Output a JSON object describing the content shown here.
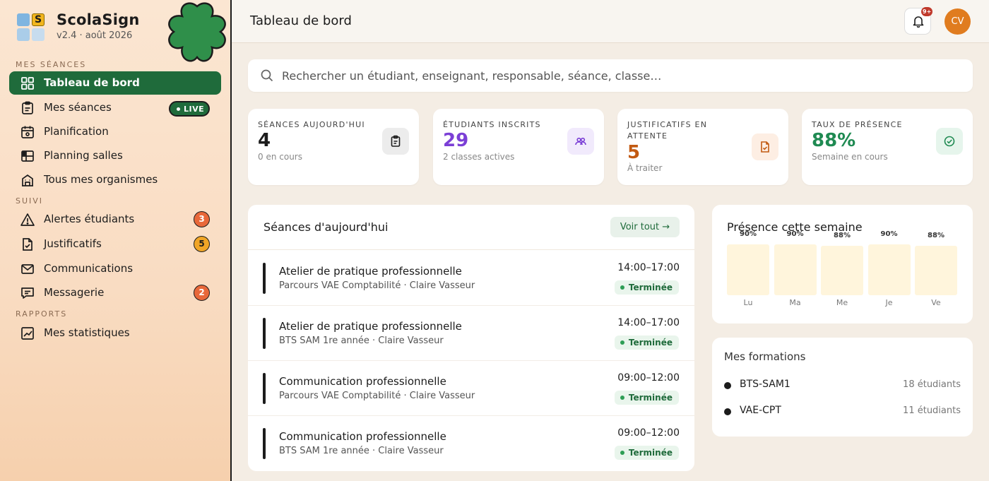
{
  "brand": {
    "name": "ScolaSign",
    "version": "v2.4 · août 2026"
  },
  "sidebar": {
    "sections": {
      "seances": "MES SÉANCES",
      "suivi": "SUIVI",
      "rapports": "RAPPORTS"
    },
    "items": [
      {
        "label": "Tableau de bord",
        "icon": "grid-icon",
        "active": true
      },
      {
        "label": "Mes séances",
        "icon": "clipboard-icon",
        "badge": "LIVE"
      },
      {
        "label": "Planification",
        "icon": "calendar-icon"
      },
      {
        "label": "Planning salles",
        "icon": "room-grid-icon"
      },
      {
        "label": "Tous mes organismes",
        "icon": "building-icon"
      },
      {
        "label": "Alertes étudiants",
        "icon": "warning-icon",
        "count": "3",
        "count_color": "#e8683a"
      },
      {
        "label": "Justificatifs",
        "icon": "document-check-icon",
        "count": "5",
        "count_color": "#f0a526"
      },
      {
        "label": "Communications",
        "icon": "mail-icon"
      },
      {
        "label": "Messagerie",
        "icon": "chat-icon",
        "count": "2",
        "count_color": "#e8683a"
      },
      {
        "label": "Mes statistiques",
        "icon": "chart-icon"
      }
    ]
  },
  "header": {
    "title": "Tableau de bord",
    "notif_count": "9+",
    "avatar_initials": "CV"
  },
  "search": {
    "placeholder": "Rechercher un étudiant, enseignant, responsable, séance, classe…"
  },
  "stats": [
    {
      "label": "Séances aujourd'hui",
      "value": "4",
      "sub": "0 en cours",
      "value_color": "#1c1c1c",
      "icon_bg": "#ececec",
      "icon": "clipboard-icon"
    },
    {
      "label": "Étudiants inscrits",
      "value": "29",
      "sub": "2 classes actives",
      "value_color": "#7b3fd6",
      "icon_bg": "#f1eafc",
      "icon": "users-icon"
    },
    {
      "label": "Justificatifs en attente",
      "value": "5",
      "sub": "À traiter",
      "value_color": "#c25a12",
      "icon_bg": "#fdeee3",
      "icon": "document-check-icon"
    },
    {
      "label": "Taux de présence",
      "value": "88%",
      "sub": "Semaine en cours",
      "value_color": "#1f8a52",
      "icon_bg": "#e6f5ec",
      "icon": "check-circle-icon"
    }
  ],
  "sessions": {
    "title": "Séances d'aujourd'hui",
    "see_all": "Voir tout →",
    "items": [
      {
        "name": "Atelier de pratique professionnelle",
        "meta": "Parcours VAE Comptabilité · Claire Vasseur",
        "time": "14:00–17:00",
        "status": "Terminée"
      },
      {
        "name": "Atelier de pratique professionnelle",
        "meta": "BTS SAM 1re année · Claire Vasseur",
        "time": "14:00–17:00",
        "status": "Terminée"
      },
      {
        "name": "Communication professionnelle",
        "meta": "Parcours VAE Comptabilité · Claire Vasseur",
        "time": "09:00–12:00",
        "status": "Terminée"
      },
      {
        "name": "Communication professionnelle",
        "meta": "BTS SAM 1re année · Claire Vasseur",
        "time": "09:00–12:00",
        "status": "Terminée"
      }
    ]
  },
  "presence": {
    "title": "Présence cette semaine",
    "chart_data": {
      "type": "bar",
      "categories": [
        "Lu",
        "Ma",
        "Me",
        "Je",
        "Ve"
      ],
      "values": [
        90,
        90,
        88,
        90,
        88
      ],
      "value_labels": [
        "90%",
        "90%",
        "88%",
        "90%",
        "88%"
      ],
      "title": "Présence cette semaine",
      "ylim": [
        0,
        100
      ]
    }
  },
  "formations": {
    "title": "Mes formations",
    "items": [
      {
        "code": "BTS-SAM1",
        "count": "18 étudiants"
      },
      {
        "code": "VAE-CPT",
        "count": "11 étudiants"
      }
    ]
  },
  "colors": {
    "accent": "#1f6b3b",
    "avatar": "#e07c1f",
    "notif": "#c0392b"
  }
}
